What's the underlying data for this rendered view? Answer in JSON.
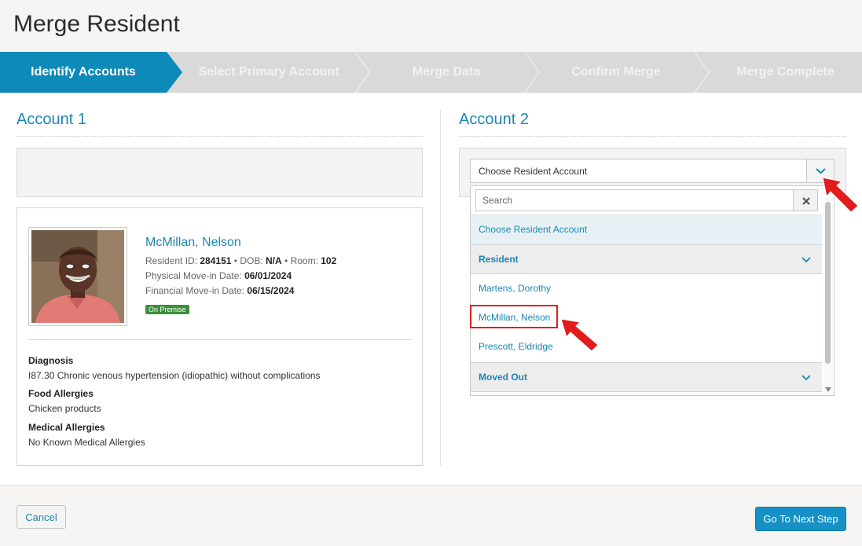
{
  "page": {
    "title": "Merge Resident"
  },
  "steps": [
    {
      "label": "Identify Accounts",
      "active": true
    },
    {
      "label": "Select Primary Account",
      "active": false
    },
    {
      "label": "Merge Data",
      "active": false
    },
    {
      "label": "Confirm Merge",
      "active": false
    },
    {
      "label": "Merge Complete",
      "active": false
    }
  ],
  "account1": {
    "title": "Account 1",
    "resident": {
      "name": "McMillan, Nelson",
      "resident_id_label": "Resident ID:",
      "resident_id": "284151",
      "dob_label": "DOB:",
      "dob": "N/A",
      "room_label": "Room:",
      "room": "102",
      "physical_move_in_label": "Physical Move-in Date:",
      "physical_move_in": "06/01/2024",
      "financial_move_in_label": "Financial Move-in Date:",
      "financial_move_in": "06/15/2024",
      "status_badge": "On Premise"
    },
    "diagnosis_label": "Diagnosis",
    "diagnosis": "I87.30 Chronic venous hypertension (idiopathic) without complications",
    "food_allergies_label": "Food Allergies",
    "food_allergies": "Chicken products",
    "medical_allergies_label": "Medical Allergies",
    "medical_allergies": "No Known Medical Allergies"
  },
  "account2": {
    "title": "Account 2",
    "select_value": "Choose Resident Account",
    "search_placeholder": "Search",
    "options": {
      "placeholder": "Choose Resident Account",
      "group_resident": "Resident",
      "residents": [
        "Martens, Dorothy",
        "McMillan, Nelson",
        "Prescott, Eldridge"
      ],
      "group_moved_out": "Moved Out"
    },
    "highlighted_option": "McMillan, Nelson"
  },
  "footer": {
    "cancel_label": "Cancel",
    "next_label": "Go To Next Step"
  },
  "colors": {
    "accent": "#0e8ab9",
    "link": "#1b87b3",
    "badge": "#3c8f3c",
    "annotation": "#e02020"
  }
}
